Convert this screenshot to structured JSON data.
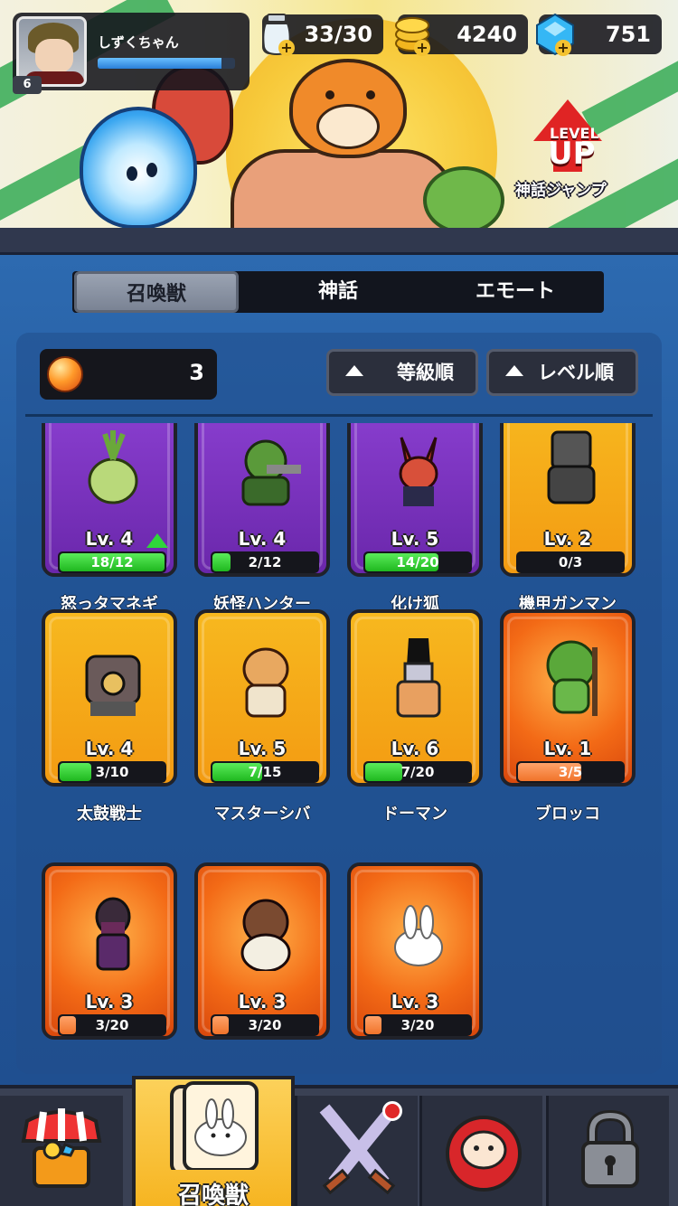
{
  "player": {
    "name": "しずくちゃん",
    "level": "6",
    "xp_fraction": 0.9
  },
  "resources": [
    {
      "name": "stamina",
      "icon": "stamina-bottle-icon",
      "value": "33/30"
    },
    {
      "name": "coins",
      "icon": "gold-coin-icon",
      "value": "4240"
    },
    {
      "name": "gems",
      "icon": "blue-gem-icon",
      "value": "751"
    }
  ],
  "banner": {
    "levelup_small": "LEVEL",
    "levelup_big": "UP",
    "caption": "神話ジャンプ"
  },
  "tabs": [
    {
      "label": "召喚獣",
      "active": true
    },
    {
      "label": "神話",
      "active": false
    },
    {
      "label": "エモート",
      "active": false
    }
  ],
  "orb_count": "3",
  "sort_buttons": [
    {
      "label": "等級順"
    },
    {
      "label": "レベル順"
    }
  ],
  "cards": [
    {
      "name": "怒っタマネギ",
      "level": "Lv. 4",
      "progress": "18/12",
      "fill": 1.0,
      "rarity": "purple",
      "upgrade": true
    },
    {
      "name": "妖怪ハンター",
      "level": "Lv. 4",
      "progress": "2/12",
      "fill": 0.17,
      "rarity": "purple",
      "upgrade": false
    },
    {
      "name": "化け狐",
      "level": "Lv. 5",
      "progress": "14/20",
      "fill": 0.7,
      "rarity": "purple",
      "upgrade": false
    },
    {
      "name": "機甲ガンマン",
      "level": "Lv. 2",
      "progress": "0/3",
      "fill": 0.0,
      "rarity": "gold",
      "upgrade": false
    },
    {
      "name": "太鼓戦士",
      "level": "Lv. 4",
      "progress": "3/10",
      "fill": 0.3,
      "rarity": "gold",
      "upgrade": false
    },
    {
      "name": "マスターシバ",
      "level": "Lv. 5",
      "progress": "7/15",
      "fill": 0.47,
      "rarity": "gold",
      "upgrade": false
    },
    {
      "name": "ドーマン",
      "level": "Lv. 6",
      "progress": "7/20",
      "fill": 0.35,
      "rarity": "gold",
      "upgrade": false
    },
    {
      "name": "ブロッコ",
      "level": "Lv. 1",
      "progress": "3/5",
      "fill": 0.6,
      "rarity": "orange",
      "upgrade": false
    },
    {
      "name": "",
      "level": "Lv. 3",
      "progress": "3/20",
      "fill": 0.15,
      "rarity": "orange",
      "upgrade": false
    },
    {
      "name": "",
      "level": "Lv. 3",
      "progress": "3/20",
      "fill": 0.15,
      "rarity": "orange",
      "upgrade": false
    },
    {
      "name": "",
      "level": "Lv. 3",
      "progress": "3/20",
      "fill": 0.15,
      "rarity": "orange",
      "upgrade": false
    }
  ],
  "nav": [
    {
      "name": "shop",
      "icon": "shop-stall-icon",
      "label": ""
    },
    {
      "name": "summons",
      "icon": "bunny-card-icon",
      "label": "召喚獣",
      "active": true
    },
    {
      "name": "battle",
      "icon": "crossed-swords-icon",
      "label": "",
      "badge": true
    },
    {
      "name": "daruma",
      "icon": "daruma-icon",
      "label": ""
    },
    {
      "name": "locked",
      "icon": "padlock-icon",
      "label": ""
    }
  ],
  "colors": {
    "panel_blue": "#2d6ab0",
    "purple_card": "#8a3fd0",
    "gold_card": "#f7b81f",
    "orange_card": "#f36a16",
    "progress_green": "#2fd63a"
  }
}
